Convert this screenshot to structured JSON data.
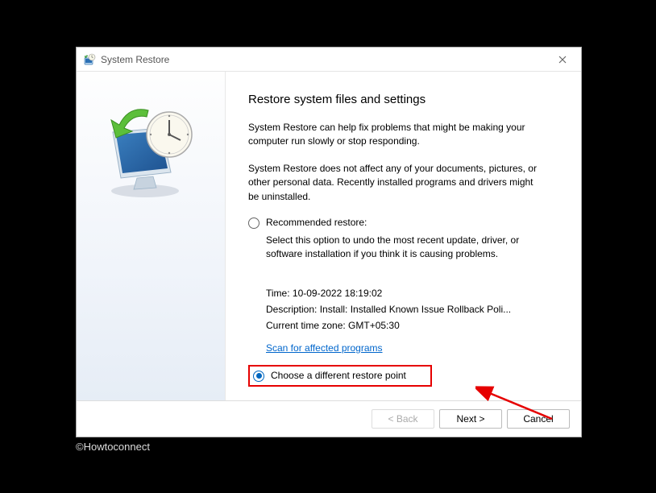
{
  "window": {
    "title": "System Restore"
  },
  "content": {
    "heading": "Restore system files and settings",
    "para1": "System Restore can help fix problems that might be making your computer run slowly or stop responding.",
    "para2": "System Restore does not affect any of your documents, pictures, or other personal data. Recently installed programs and drivers might be uninstalled.",
    "recommended_label": "Recommended restore:",
    "recommended_desc": "Select this option to undo the most recent update, driver, or software installation if you think it is causing problems.",
    "time_label": "Time: 10-09-2022 18:19:02",
    "desc_label": "Description: Install: Installed Known Issue Rollback Poli...",
    "tz_label": "Current time zone: GMT+05:30",
    "scan_link": "Scan for affected programs",
    "choose_label": "Choose a different restore point"
  },
  "buttons": {
    "back": "< Back",
    "next": "Next >",
    "cancel": "Cancel"
  },
  "copyright": "©Howtoconnect"
}
